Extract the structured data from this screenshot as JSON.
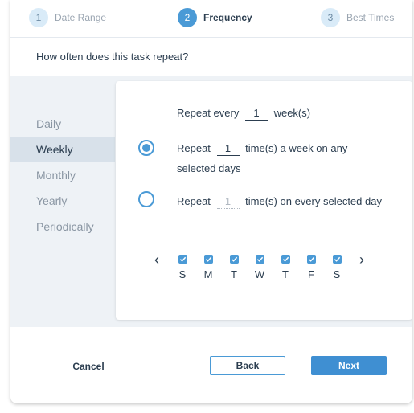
{
  "stepper": {
    "steps": [
      {
        "number": "1",
        "label": "Date Range",
        "state": "inactive"
      },
      {
        "number": "2",
        "label": "Frequency",
        "state": "active"
      },
      {
        "number": "3",
        "label": "Best Times",
        "state": "inactive"
      }
    ]
  },
  "question": "How often does this task repeat?",
  "sidebar": {
    "items": [
      {
        "label": "Daily",
        "selected": false
      },
      {
        "label": "Weekly",
        "selected": true
      },
      {
        "label": "Monthly",
        "selected": false
      },
      {
        "label": "Yearly",
        "selected": false
      },
      {
        "label": "Periodically",
        "selected": false
      }
    ]
  },
  "panel": {
    "repeat_every": {
      "prefix": "Repeat every",
      "value": "1",
      "suffix": "week(s)"
    },
    "option1": {
      "checked": true,
      "prefix": "Repeat",
      "value": "1",
      "suffix": "time(s) a week on any",
      "line2": "selected days"
    },
    "option2": {
      "checked": false,
      "prefix": "Repeat",
      "value": "1",
      "suffix": "time(s) on every selected day"
    },
    "days": [
      {
        "label": "S",
        "checked": true
      },
      {
        "label": "M",
        "checked": true
      },
      {
        "label": "T",
        "checked": true
      },
      {
        "label": "W",
        "checked": true
      },
      {
        "label": "T",
        "checked": true
      },
      {
        "label": "F",
        "checked": true
      },
      {
        "label": "S",
        "checked": true
      }
    ],
    "prev_icon": "chevron-left-icon",
    "next_icon": "chevron-right-icon"
  },
  "footer": {
    "cancel_label": "Cancel",
    "back_label": "Back",
    "next_label": "Next"
  },
  "colors": {
    "accent": "#4a9ad6",
    "primary_button": "#3f8fd2",
    "sidebar_selected": "#d8e1ea",
    "band": "#eef2f6"
  }
}
